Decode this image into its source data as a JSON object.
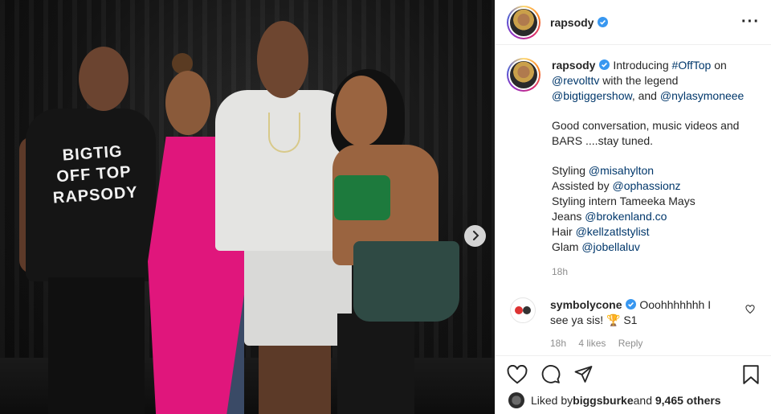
{
  "post": {
    "username": "rapsody",
    "photo_alt": "",
    "shirt_text": [
      "BIGTIG",
      "OFF TOP",
      "RAPSODY"
    ]
  },
  "caption": {
    "username": "rapsody",
    "text_intro": " Introducing ",
    "hashtag": "#OffTop",
    "text_on": " on",
    "mention1": "@revolttv",
    "text_with": " with the legend",
    "mention2": "@bigtiggershow",
    "text_and": ", and ",
    "mention3": "@nylasymoneee",
    "para2": "Good conversation, music videos and BARS ....stay tuned.",
    "credits": [
      {
        "label": "Styling ",
        "handle": "@misahylton"
      },
      {
        "label": "Assisted by ",
        "handle": "@ophassionz"
      },
      {
        "label": "Styling intern Tameeka Mays",
        "handle": ""
      },
      {
        "label": "Jeans ",
        "handle": "@brokenland.co"
      },
      {
        "label": "Hair ",
        "handle": "@kellzatlstylist"
      },
      {
        "label": "Glam ",
        "handle": "@jobellaluv"
      }
    ],
    "time": "18h"
  },
  "comment": {
    "username": "symbolycone",
    "text": " Ooohhhhhhh I see ya sis! 🏆 S1",
    "time": "18h",
    "likes": "4 likes",
    "reply": "Reply"
  },
  "likes": {
    "prefix": "Liked by ",
    "user": "biggsburke",
    "middle": " and ",
    "count": "9,465 others"
  },
  "icons": {
    "verified": "verified-badge-icon",
    "more": "more-options-icon",
    "next": "chevron-right-icon",
    "like": "heart-icon",
    "comment": "comment-icon",
    "share": "share-icon",
    "save": "bookmark-icon"
  },
  "colors": {
    "link": "#00376b",
    "verified": "#3897f0",
    "meta": "#8e8e8e"
  }
}
